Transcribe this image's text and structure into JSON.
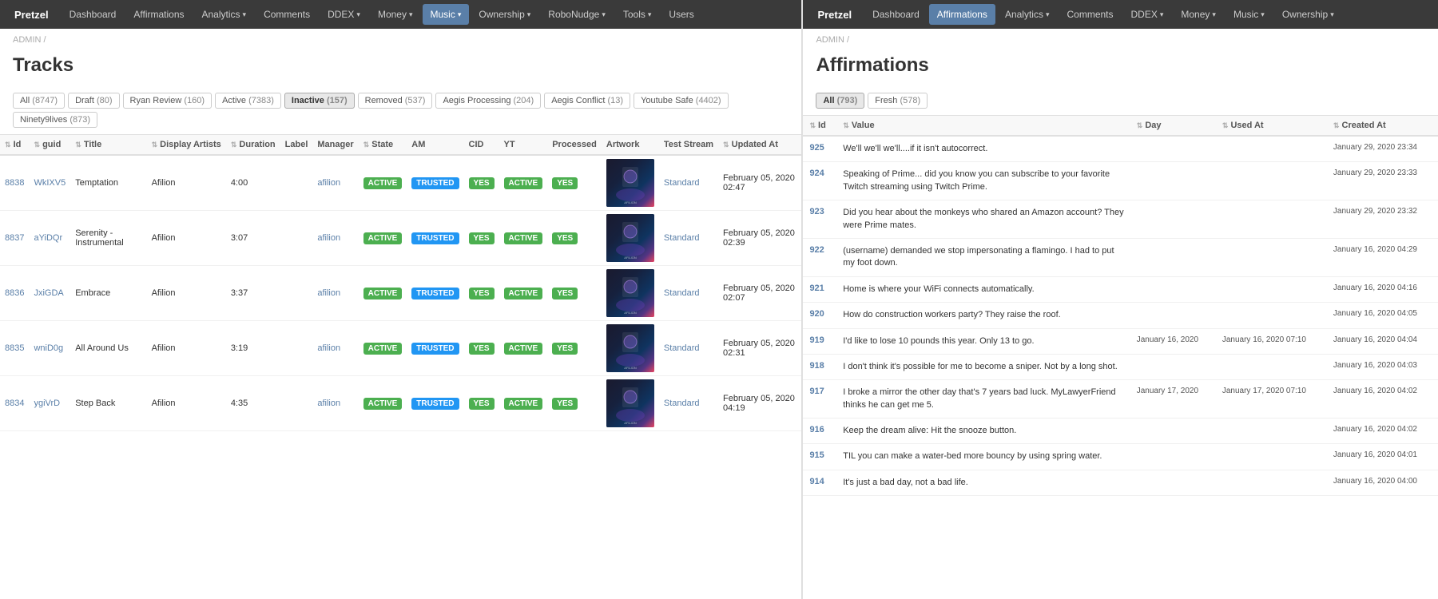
{
  "left": {
    "brand": "Pretzel",
    "nav": [
      {
        "label": "Dashboard",
        "active": false
      },
      {
        "label": "Affirmations",
        "active": false
      },
      {
        "label": "Analytics",
        "active": false,
        "dropdown": true
      },
      {
        "label": "Comments",
        "active": false
      },
      {
        "label": "DDEX",
        "active": false,
        "dropdown": true
      },
      {
        "label": "Money",
        "active": false,
        "dropdown": true
      },
      {
        "label": "Music",
        "active": true,
        "dropdown": true
      },
      {
        "label": "Ownership",
        "active": false,
        "dropdown": true
      },
      {
        "label": "RoboNudge",
        "active": false,
        "dropdown": true
      },
      {
        "label": "Tools",
        "active": false,
        "dropdown": true
      },
      {
        "label": "Users",
        "active": false
      }
    ],
    "breadcrumb": "ADMIN /",
    "page_title": "Tracks",
    "filter_tabs": [
      {
        "label": "All",
        "count": "8747",
        "selected": false
      },
      {
        "label": "Draft",
        "count": "80",
        "selected": false
      },
      {
        "label": "Ryan Review",
        "count": "160",
        "selected": false
      },
      {
        "label": "Active",
        "count": "7383",
        "selected": false
      },
      {
        "label": "Inactive",
        "count": "157",
        "selected": true
      },
      {
        "label": "Removed",
        "count": "537",
        "selected": false
      },
      {
        "label": "Aegis Processing",
        "count": "204",
        "selected": false
      },
      {
        "label": "Aegis Conflict",
        "count": "13",
        "selected": false
      },
      {
        "label": "Youtube Safe",
        "count": "4402",
        "selected": false
      },
      {
        "label": "Ninety9lives",
        "count": "873",
        "selected": false
      }
    ],
    "columns": [
      "Id",
      "guid",
      "Title",
      "Display Artists",
      "Duration",
      "Label",
      "Manager",
      "State",
      "AM",
      "CID",
      "YT",
      "Processed",
      "Artwork",
      "Test Stream",
      "Updated At"
    ],
    "tracks": [
      {
        "id": "8838",
        "guid": "WkIXV5",
        "title": "Temptation",
        "artist": "Afilion",
        "duration": "4:00",
        "label": "",
        "manager": "afilion",
        "state": "ACTIVE",
        "am": "TRUSTED",
        "cid": "YES",
        "yt": "ACTIVE",
        "processed": "YES",
        "test_stream": "Standard",
        "updated_at": "February 05, 2020 02:47"
      },
      {
        "id": "8837",
        "guid": "aYiDQr",
        "title": "Serenity - Instrumental",
        "artist": "Afilion",
        "duration": "3:07",
        "label": "",
        "manager": "afilion",
        "state": "ACTIVE",
        "am": "TRUSTED",
        "cid": "YES",
        "yt": "ACTIVE",
        "processed": "YES",
        "test_stream": "Standard",
        "updated_at": "February 05, 2020 02:39"
      },
      {
        "id": "8836",
        "guid": "JxiGDA",
        "title": "Embrace",
        "artist": "Afilion",
        "duration": "3:37",
        "label": "",
        "manager": "afilion",
        "state": "ACTIVE",
        "am": "TRUSTED",
        "cid": "YES",
        "yt": "ACTIVE",
        "processed": "YES",
        "test_stream": "Standard",
        "updated_at": "February 05, 2020 02:07"
      },
      {
        "id": "8835",
        "guid": "wniD0g",
        "title": "All Around Us",
        "artist": "Afilion",
        "duration": "3:19",
        "label": "",
        "manager": "afilion",
        "state": "ACTIVE",
        "am": "TRUSTED",
        "cid": "YES",
        "yt": "ACTIVE",
        "processed": "YES",
        "test_stream": "Standard",
        "updated_at": "February 05, 2020 02:31"
      },
      {
        "id": "8834",
        "guid": "ygiVrD",
        "title": "Step Back",
        "artist": "Afilion",
        "duration": "4:35",
        "label": "",
        "manager": "afilion",
        "state": "ACTIVE",
        "am": "TRUSTED",
        "cid": "YES",
        "yt": "ACTIVE",
        "processed": "YES",
        "test_stream": "Standard",
        "updated_at": "February 05, 2020 04:19"
      }
    ]
  },
  "right": {
    "brand": "Pretzel",
    "nav": [
      {
        "label": "Dashboard",
        "active": false
      },
      {
        "label": "Affirmations",
        "active": true
      },
      {
        "label": "Analytics",
        "active": false,
        "dropdown": true
      },
      {
        "label": "Comments",
        "active": false
      },
      {
        "label": "DDEX",
        "active": false,
        "dropdown": true
      },
      {
        "label": "Money",
        "active": false,
        "dropdown": true
      },
      {
        "label": "Music",
        "active": false,
        "dropdown": true
      },
      {
        "label": "Ownership",
        "active": false,
        "dropdown": true
      }
    ],
    "breadcrumb": "ADMIN /",
    "page_title": "Affirmations",
    "filter_tabs": [
      {
        "label": "All",
        "count": "793",
        "selected": true
      },
      {
        "label": "Fresh",
        "count": "578",
        "selected": false
      }
    ],
    "columns": [
      "Id",
      "Value",
      "Day",
      "Used At",
      "Created At"
    ],
    "affirmations": [
      {
        "id": "925",
        "value": "We'll we'll we'll....if it isn't autocorrect.",
        "day": "",
        "used_at": "",
        "created_at": "January 29, 2020 23:34"
      },
      {
        "id": "924",
        "value": "Speaking of Prime... did you know you can subscribe to your favorite Twitch streaming using Twitch Prime.",
        "day": "",
        "used_at": "",
        "created_at": "January 29, 2020 23:33"
      },
      {
        "id": "923",
        "value": "Did you hear about the monkeys who shared an Amazon account? They were Prime mates.",
        "day": "",
        "used_at": "",
        "created_at": "January 29, 2020 23:32"
      },
      {
        "id": "922",
        "value": "(username) demanded we stop impersonating a flamingo. I had to put my foot down.",
        "day": "",
        "used_at": "",
        "created_at": "January 16, 2020 04:29"
      },
      {
        "id": "921",
        "value": "Home is where your WiFi connects automatically.",
        "day": "",
        "used_at": "",
        "created_at": "January 16, 2020 04:16"
      },
      {
        "id": "920",
        "value": "How do construction workers party? They raise the roof.",
        "day": "",
        "used_at": "",
        "created_at": "January 16, 2020 04:05"
      },
      {
        "id": "919",
        "value": "I'd like to lose 10 pounds this year. Only 13 to go.",
        "day": "January 16, 2020",
        "used_at": "January 16, 2020 07:10",
        "created_at": "January 16, 2020 04:04"
      },
      {
        "id": "918",
        "value": "I don't think it's possible for me to become a sniper. Not by a long shot.",
        "day": "",
        "used_at": "",
        "created_at": "January 16, 2020 04:03"
      },
      {
        "id": "917",
        "value": "I broke a mirror the other day that's 7 years bad luck. MyLawyerFriend thinks he can get me 5.",
        "day": "January 17, 2020",
        "used_at": "January 17, 2020 07:10",
        "created_at": "January 16, 2020 04:02"
      },
      {
        "id": "916",
        "value": "Keep the dream alive: Hit the snooze button.",
        "day": "",
        "used_at": "",
        "created_at": "January 16, 2020 04:02"
      },
      {
        "id": "915",
        "value": "TIL you can make a water-bed more bouncy by using spring water.",
        "day": "",
        "used_at": "",
        "created_at": "January 16, 2020 04:01"
      },
      {
        "id": "914",
        "value": "It's just a bad day, not a bad life.",
        "day": "",
        "used_at": "",
        "created_at": "January 16, 2020 04:00"
      }
    ]
  }
}
